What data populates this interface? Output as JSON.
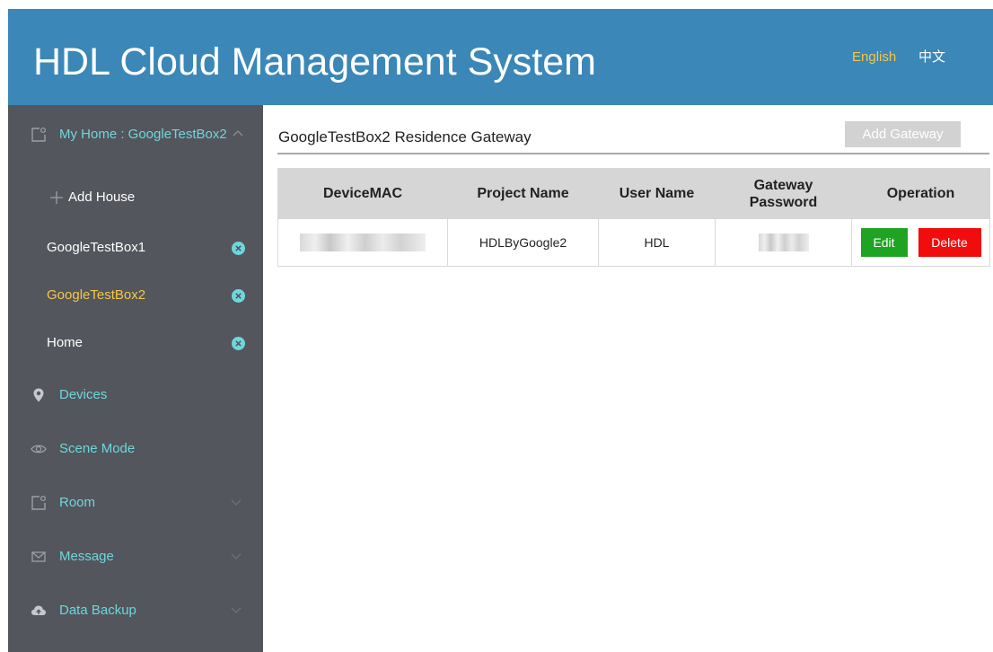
{
  "header": {
    "title": "HDL Cloud Management System",
    "languages": [
      "English",
      "中文"
    ],
    "active_language_color": "#f4c64a",
    "background_color": "#3a87b8"
  },
  "sidebar": {
    "background_color": "#53565c",
    "home_selector": "My Home : GoogleTestBox2",
    "add_house": "Add House",
    "houses": [
      {
        "name": "GoogleTestBox1",
        "selected": false
      },
      {
        "name": "GoogleTestBox2",
        "selected": true
      },
      {
        "name": "Home",
        "selected": false
      }
    ],
    "nav": [
      {
        "label": "Devices",
        "icon": "location-pin-icon"
      },
      {
        "label": "Scene Mode",
        "icon": "eye-icon"
      },
      {
        "label": "Room",
        "icon": "room-icon",
        "expandable": true
      },
      {
        "label": "Message",
        "icon": "envelope-icon",
        "expandable": true
      },
      {
        "label": "Data Backup",
        "icon": "cloud-upload-icon",
        "expandable": true
      }
    ]
  },
  "main": {
    "title": "GoogleTestBox2 Residence Gateway",
    "add_gateway_label": "Add Gateway",
    "table": {
      "headers": [
        "DeviceMAC",
        "Project Name",
        "User Name",
        "Gateway Password",
        "Operation"
      ],
      "rows": [
        {
          "device_mac": "",
          "project_name": "HDLByGoogle2",
          "user_name": "HDL",
          "gateway_password": ""
        }
      ],
      "edit_label": "Edit",
      "delete_label": "Delete"
    }
  },
  "colors": {
    "accent_teal": "#6dd7dd",
    "edit_green": "#1fa322",
    "delete_red": "#f10d0d"
  }
}
